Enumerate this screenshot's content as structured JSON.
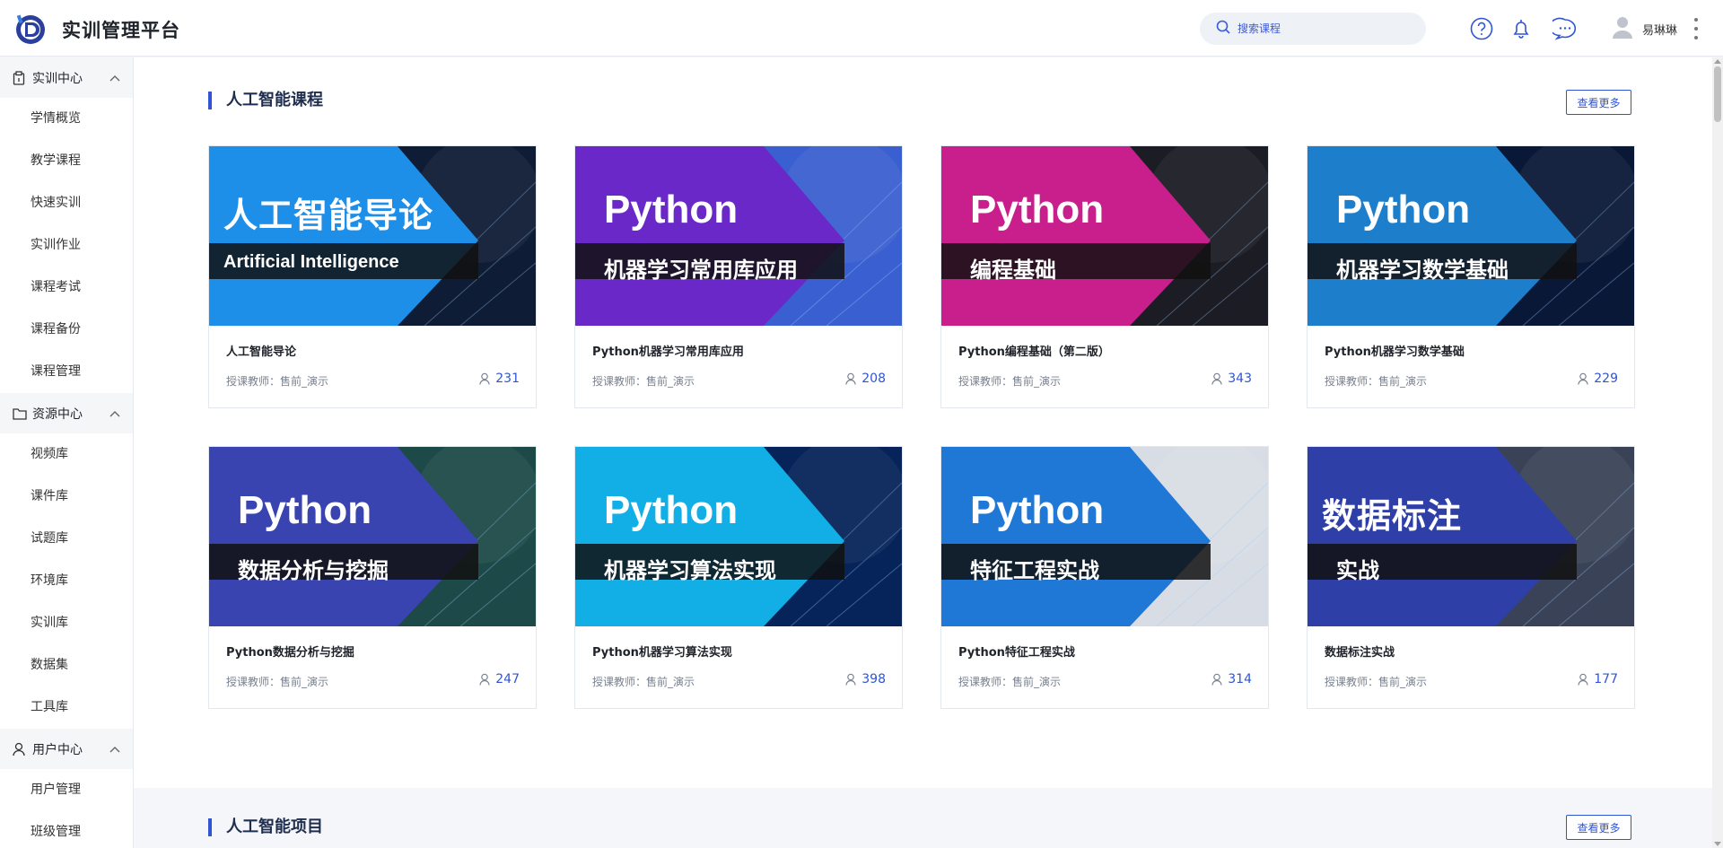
{
  "header": {
    "app_title": "实训管理平台",
    "search_placeholder": "搜索课程",
    "username": "易琳琳"
  },
  "sidebar": {
    "groups": [
      {
        "label": "实训中心",
        "icon": "clipboard-icon",
        "items": [
          "学情概览",
          "教学课程",
          "快速实训",
          "实训作业",
          "课程考试",
          "课程备份",
          "课程管理"
        ]
      },
      {
        "label": "资源中心",
        "icon": "folder-icon",
        "items": [
          "视频库",
          "课件库",
          "试题库",
          "环境库",
          "实训库",
          "数据集",
          "工具库"
        ]
      },
      {
        "label": "用户中心",
        "icon": "user-icon",
        "items": [
          "用户管理",
          "班级管理"
        ]
      }
    ]
  },
  "section_ai_courses": {
    "title": "人工智能课程",
    "more_label": "查看更多",
    "courses": [
      {
        "name": "人工智能导论",
        "banner_main": "人工智能导论",
        "banner_sub": "Artificial Intelligence",
        "teacher": "授课教师：售前_演示",
        "students": "231",
        "color": "#1e8fe8",
        "bg": "#0f1c35"
      },
      {
        "name": "Python机器学习常用库应用",
        "banner_main": "Python",
        "banner_sub": "机器学习常用库应用",
        "teacher": "授课教师：售前_演示",
        "students": "208",
        "color": "#6a28c9",
        "bg": "#3a5fd0"
      },
      {
        "name": "Python编程基础（第二版）",
        "banner_main": "Python",
        "banner_sub": "编程基础",
        "teacher": "授课教师：售前_演示",
        "students": "343",
        "color": "#c81f8c",
        "bg": "#1c1c24"
      },
      {
        "name": "Python机器学习数学基础",
        "banner_main": "Python",
        "banner_sub": "机器学习数学基础",
        "teacher": "授课教师：售前_演示",
        "students": "229",
        "color": "#1d7fcc",
        "bg": "#0a1838"
      },
      {
        "name": "Python数据分析与挖掘",
        "banner_main": "Python",
        "banner_sub": "数据分析与挖掘",
        "teacher": "授课教师：售前_演示",
        "students": "247",
        "color": "#3a44b0",
        "bg": "#1d4a48"
      },
      {
        "name": "Python机器学习算法实现",
        "banner_main": "Python",
        "banner_sub": "机器学习算法实现",
        "teacher": "授课教师：售前_演示",
        "students": "398",
        "color": "#12aee6",
        "bg": "#06245a"
      },
      {
        "name": "Python特征工程实战",
        "banner_main": "Python",
        "banner_sub": "特征工程实战",
        "teacher": "授课教师：售前_演示",
        "students": "314",
        "color": "#1f78d6",
        "bg": "#d8dce4"
      },
      {
        "name": "数据标注实战",
        "banner_main": "数据标注",
        "banner_sub": "实战",
        "teacher": "授课教师：售前_演示",
        "students": "177",
        "color": "#2f3fa8",
        "bg": "#3a4258"
      }
    ]
  },
  "section_ai_projects": {
    "title": "人工智能项目",
    "more_label": "查看更多"
  },
  "colors": {
    "accent": "#2f55d4",
    "header_bg": "#ffffff",
    "page_bg": "#f4f6f9"
  }
}
